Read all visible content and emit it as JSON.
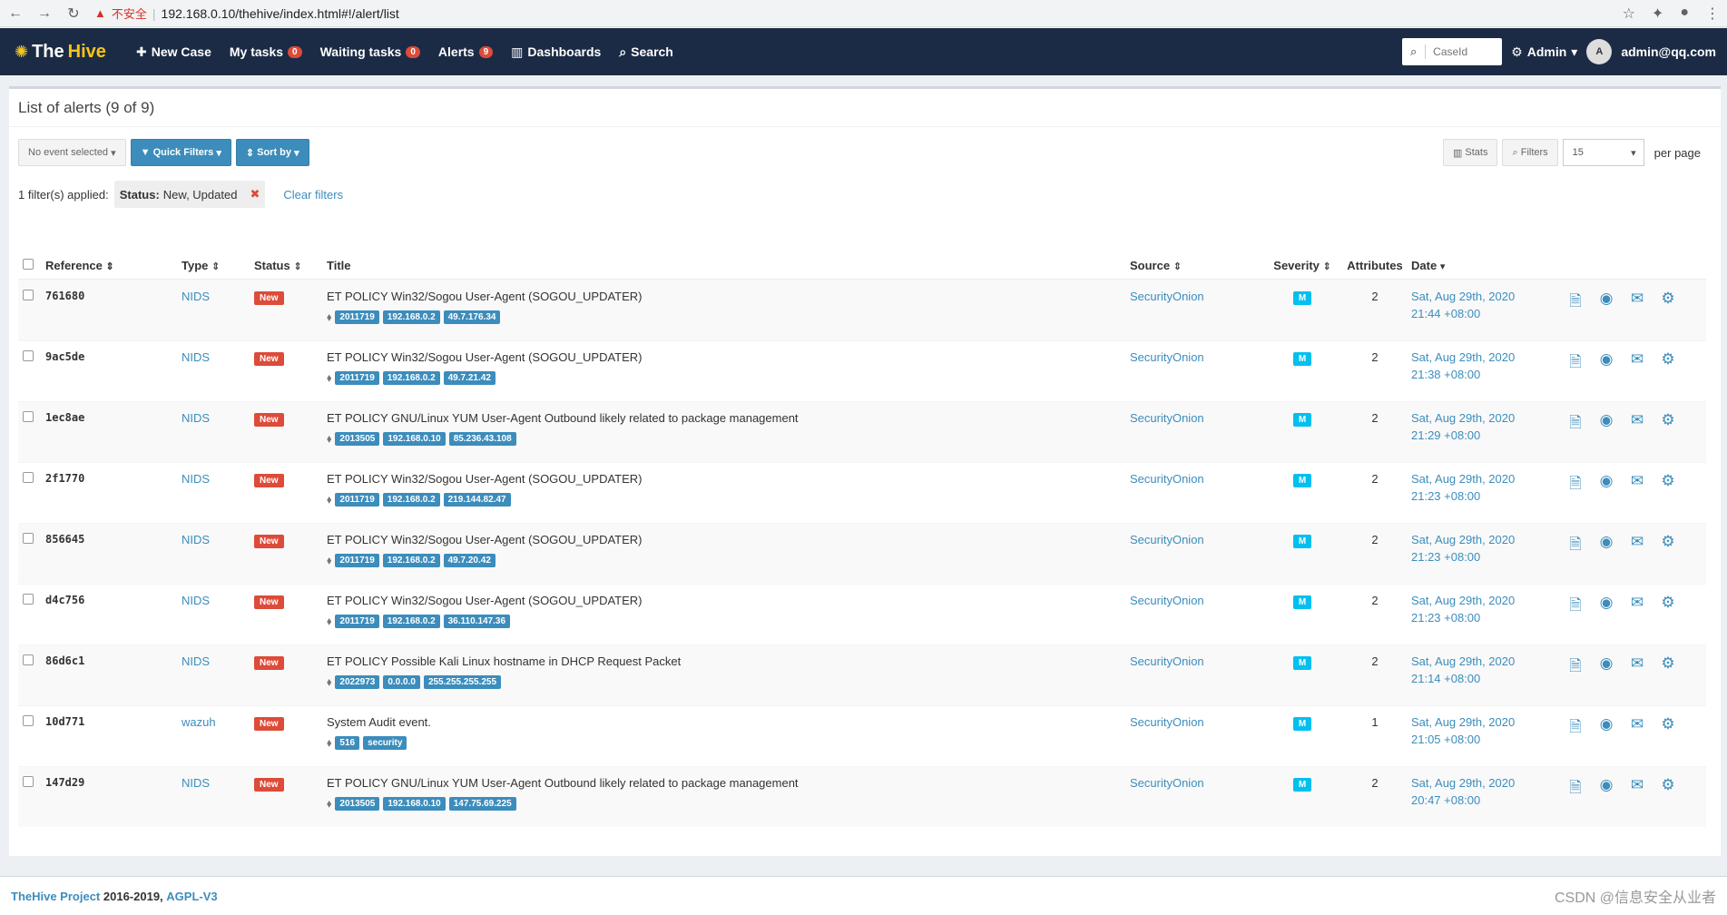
{
  "browser": {
    "warning": "不安全",
    "url": "192.168.0.10/thehive/index.html#!/alert/list"
  },
  "nav": {
    "logo_the": "The",
    "logo_hive": "Hive",
    "new_case": "New Case",
    "my_tasks": "My tasks",
    "my_tasks_count": "0",
    "waiting_tasks": "Waiting tasks",
    "waiting_tasks_count": "0",
    "alerts": "Alerts",
    "alerts_count": "9",
    "dashboards": "Dashboards",
    "search": "Search",
    "caseid_placeholder": "CaseId",
    "admin": "Admin",
    "avatar": "A",
    "user": "admin@qq.com"
  },
  "page": {
    "title": "List of alerts (9 of 9)",
    "no_event": "No event selected",
    "quick_filters": "Quick Filters",
    "sort_by": "Sort by",
    "stats": "Stats",
    "filters": "Filters",
    "per_page_value": "15",
    "per_page": "per page",
    "filters_applied": "1 filter(s) applied:",
    "filter_key": "Status:",
    "filter_value": "New, Updated",
    "clear_filters": "Clear filters"
  },
  "table": {
    "headers": {
      "reference": "Reference",
      "type": "Type",
      "status": "Status",
      "title": "Title",
      "source": "Source",
      "severity": "Severity",
      "attributes": "Attributes",
      "date": "Date"
    },
    "rows": [
      {
        "ref": "761680",
        "type": "NIDS",
        "status": "New",
        "title": "ET POLICY Win32/Sogou User-Agent (SOGOU_UPDATER)",
        "tags": [
          "2011719",
          "192.168.0.2",
          "49.7.176.34"
        ],
        "source": "SecurityOnion",
        "severity": "M",
        "attributes": "2",
        "date1": "Sat, Aug 29th, 2020",
        "date2": "21:44 +08:00"
      },
      {
        "ref": "9ac5de",
        "type": "NIDS",
        "status": "New",
        "title": "ET POLICY Win32/Sogou User-Agent (SOGOU_UPDATER)",
        "tags": [
          "2011719",
          "192.168.0.2",
          "49.7.21.42"
        ],
        "source": "SecurityOnion",
        "severity": "M",
        "attributes": "2",
        "date1": "Sat, Aug 29th, 2020",
        "date2": "21:38 +08:00"
      },
      {
        "ref": "1ec8ae",
        "type": "NIDS",
        "status": "New",
        "title": "ET POLICY GNU/Linux YUM User-Agent Outbound likely related to package management",
        "tags": [
          "2013505",
          "192.168.0.10",
          "85.236.43.108"
        ],
        "source": "SecurityOnion",
        "severity": "M",
        "attributes": "2",
        "date1": "Sat, Aug 29th, 2020",
        "date2": "21:29 +08:00"
      },
      {
        "ref": "2f1770",
        "type": "NIDS",
        "status": "New",
        "title": "ET POLICY Win32/Sogou User-Agent (SOGOU_UPDATER)",
        "tags": [
          "2011719",
          "192.168.0.2",
          "219.144.82.47"
        ],
        "source": "SecurityOnion",
        "severity": "M",
        "attributes": "2",
        "date1": "Sat, Aug 29th, 2020",
        "date2": "21:23 +08:00"
      },
      {
        "ref": "856645",
        "type": "NIDS",
        "status": "New",
        "title": "ET POLICY Win32/Sogou User-Agent (SOGOU_UPDATER)",
        "tags": [
          "2011719",
          "192.168.0.2",
          "49.7.20.42"
        ],
        "source": "SecurityOnion",
        "severity": "M",
        "attributes": "2",
        "date1": "Sat, Aug 29th, 2020",
        "date2": "21:23 +08:00"
      },
      {
        "ref": "d4c756",
        "type": "NIDS",
        "status": "New",
        "title": "ET POLICY Win32/Sogou User-Agent (SOGOU_UPDATER)",
        "tags": [
          "2011719",
          "192.168.0.2",
          "36.110.147.36"
        ],
        "source": "SecurityOnion",
        "severity": "M",
        "attributes": "2",
        "date1": "Sat, Aug 29th, 2020",
        "date2": "21:23 +08:00"
      },
      {
        "ref": "86d6c1",
        "type": "NIDS",
        "status": "New",
        "title": "ET POLICY Possible Kali Linux hostname in DHCP Request Packet",
        "tags": [
          "2022973",
          "0.0.0.0",
          "255.255.255.255"
        ],
        "source": "SecurityOnion",
        "severity": "M",
        "attributes": "2",
        "date1": "Sat, Aug 29th, 2020",
        "date2": "21:14 +08:00"
      },
      {
        "ref": "10d771",
        "type": "wazuh",
        "status": "New",
        "title": "System Audit event.",
        "tags": [
          "516",
          "security"
        ],
        "source": "SecurityOnion",
        "severity": "M",
        "attributes": "1",
        "date1": "Sat, Aug 29th, 2020",
        "date2": "21:05 +08:00"
      },
      {
        "ref": "147d29",
        "type": "NIDS",
        "status": "New",
        "title": "ET POLICY GNU/Linux YUM User-Agent Outbound likely related to package management",
        "tags": [
          "2013505",
          "192.168.0.10",
          "147.75.69.225"
        ],
        "source": "SecurityOnion",
        "severity": "M",
        "attributes": "2",
        "date1": "Sat, Aug 29th, 2020",
        "date2": "20:47 +08:00"
      }
    ]
  },
  "footer": {
    "brand": "TheHive Project",
    "years": " 2016-2019, ",
    "license": "AGPL-V3",
    "watermark": "CSDN @信息安全从业者"
  }
}
